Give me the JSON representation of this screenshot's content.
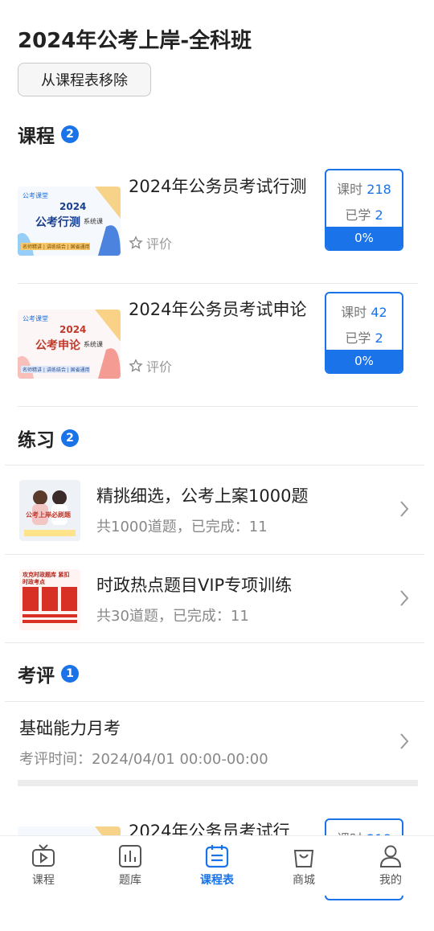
{
  "page_title": "2024年公考上岸-全科班",
  "remove_button": "从课程表移除",
  "sections": {
    "courses": {
      "title": "课程",
      "badge": "2"
    },
    "practice": {
      "title": "练习",
      "badge": "2"
    },
    "exams": {
      "title": "考评",
      "badge": "1"
    }
  },
  "courses": [
    {
      "title": "2024年公务员考试行测",
      "rate_label": "评价",
      "hours_label": "课时",
      "hours": "218",
      "learned_label": "已学",
      "learned": "2",
      "progress": "0%",
      "thumb": {
        "logo": "公考课堂",
        "year": "2024",
        "name": "公考行测",
        "tag": "系统课",
        "strip": "名师精讲 | 讲练结合 | 国省通用"
      }
    },
    {
      "title": "2024年公务员考试申论",
      "rate_label": "评价",
      "hours_label": "课时",
      "hours": "42",
      "learned_label": "已学",
      "learned": "2",
      "progress": "0%",
      "thumb": {
        "logo": "公考课堂",
        "year": "2024",
        "name": "公考申论",
        "tag": "系统课",
        "strip": "名师精讲 | 讲练结合 | 国省通用"
      }
    }
  ],
  "practice": [
    {
      "title": "精挑细选，公考上案1000题",
      "subtitle": "共1000道题，已完成：11",
      "thumb_text": "公考上岸必刷题"
    },
    {
      "title": "时政热点题目VIP专项训练",
      "subtitle": "共30道题，已完成：11",
      "thumb_text": "攻克时政题库 紧扣时政考点"
    }
  ],
  "exam": {
    "title": "基础能力月考",
    "subtitle": "考评时间：2024/04/01 00:00-00:00"
  },
  "peek_card": {
    "title": "2024年公务员考试行",
    "hours_label": "课时",
    "hours": "218"
  },
  "tabs": [
    {
      "label": "课程",
      "icon": "tv-icon"
    },
    {
      "label": "题库",
      "icon": "chart-icon"
    },
    {
      "label": "课程表",
      "icon": "calendar-icon",
      "active": true
    },
    {
      "label": "商城",
      "icon": "bag-icon"
    },
    {
      "label": "我的",
      "icon": "user-icon"
    }
  ],
  "colors": {
    "accent": "#1a73e8",
    "text": "#222222",
    "muted": "#888888"
  }
}
